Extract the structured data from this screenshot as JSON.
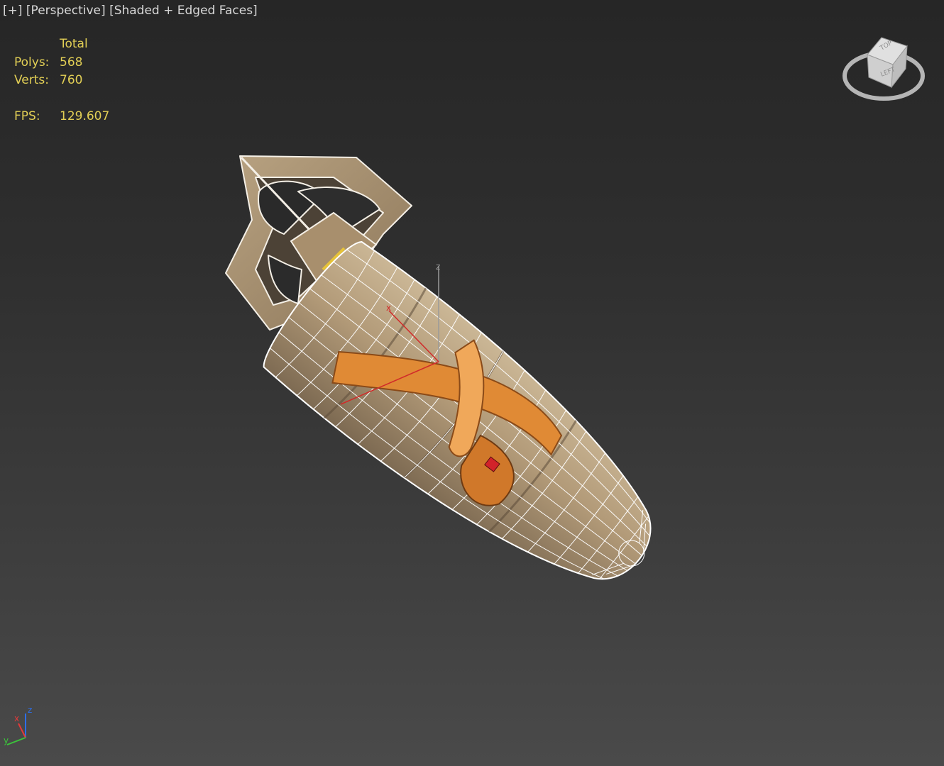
{
  "viewport": {
    "menu_label": "[+]",
    "view_label": "[Perspective]",
    "shading_label": "[Shaded + Edged Faces]"
  },
  "stats": {
    "header": "Total",
    "polys_label": "Polys:",
    "polys_value": "568",
    "verts_label": "Verts:",
    "verts_value": "760",
    "fps_label": "FPS:",
    "fps_value": "129.607"
  },
  "viewcube": {
    "face_top": "TOP",
    "face_left": "LEFT"
  },
  "axis_tripod": {
    "x": "x",
    "y": "y",
    "z": "z"
  },
  "gizmo": {
    "x": "x",
    "z": "z"
  },
  "colors": {
    "stats_text": "#e2cf55",
    "label_text": "#d8d8d8",
    "wireframe": "#ffffff",
    "body_texture": "#b39e7f",
    "decal_orange": "#e08a35"
  }
}
